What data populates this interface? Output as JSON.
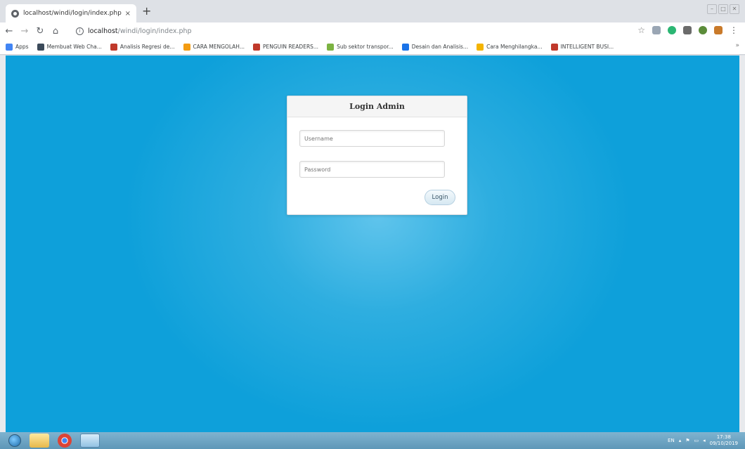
{
  "browser": {
    "tab": {
      "title": "localhost/windi/login/index.php",
      "close": "×"
    },
    "new_tab": "+",
    "url": {
      "host": "localhost",
      "path": "/windi/login/index.php"
    },
    "bookmarks": [
      {
        "label": "Apps",
        "icon": "apps-grid-icon",
        "color": "#4285f4"
      },
      {
        "label": "Membuat Web Cha...",
        "icon": "bookmark-icon",
        "color": "#3b4a5a"
      },
      {
        "label": "Analisis Regresi de...",
        "icon": "bookmark-icon",
        "color": "#c0392b"
      },
      {
        "label": "CARA MENGOLAH...",
        "icon": "bookmark-icon",
        "color": "#f39c12"
      },
      {
        "label": "PENGUIN READERS...",
        "icon": "bookmark-icon",
        "color": "#c0392b"
      },
      {
        "label": "Sub sektor transpor...",
        "icon": "bookmark-icon",
        "color": "#7cb342"
      },
      {
        "label": "Desain dan Analisis...",
        "icon": "bookmark-icon",
        "color": "#1a73e8"
      },
      {
        "label": "Cara Menghilangka...",
        "icon": "bookmark-icon",
        "color": "#f4b400"
      },
      {
        "label": "INTELLIGENT BUSI...",
        "icon": "bookmark-icon",
        "color": "#c0392b"
      }
    ],
    "bookmarks_more": "»"
  },
  "login": {
    "title": "Login Admin",
    "username_placeholder": "Username",
    "password_placeholder": "Password",
    "button": "Login"
  },
  "taskbar": {
    "lang": "EN",
    "time": "17:38",
    "date": "09/10/2019"
  }
}
